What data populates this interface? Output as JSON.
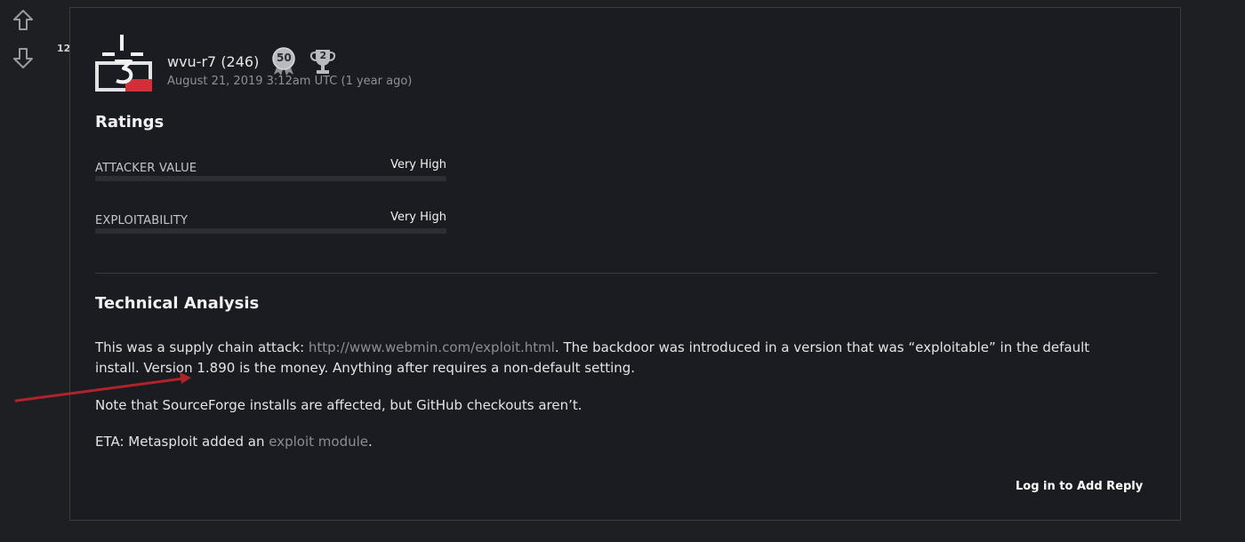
{
  "vote": {
    "count": "12",
    "up_icon": "arrow-up-icon",
    "down_icon": "arrow-down-icon"
  },
  "post": {
    "author": "wvu-r7 (246)",
    "badges": [
      {
        "icon": "ribbon-badge-icon",
        "label": "50"
      },
      {
        "icon": "trophy-badge-icon",
        "label": "2"
      }
    ],
    "timestamp": "August 21, 2019 3:12am UTC (1 year ago)"
  },
  "ratings": {
    "title": "Ratings",
    "items": [
      {
        "label": "ATTACKER VALUE",
        "value": "Very High",
        "level": 1.0
      },
      {
        "label": "EXPLOITABILITY",
        "value": "Very High",
        "level": 1.0
      }
    ]
  },
  "analysis": {
    "title": "Technical Analysis",
    "p1_before": "This was a supply chain attack: ",
    "p1_link": "http://www.webmin.com/exploit.html",
    "p1_after": ". The backdoor was introduced in a version that was “exploitable” in the default install. Version 1.890 is the money. Anything after requires a non-default setting.",
    "p2": "Note that SourceForge installs are affected, but GitHub checkouts aren’t.",
    "p3_before": "ETA: Metasploit added an ",
    "p3_link": "exploit module",
    "p3_after": "."
  },
  "actions": {
    "reply": "Log in to Add Reply"
  },
  "colors": {
    "background": "#1e1f22",
    "card": "#1b1c21",
    "link": "#8d8e95",
    "annotation_arrow": "#b0232a",
    "avatar_accent": "#d0303a"
  }
}
